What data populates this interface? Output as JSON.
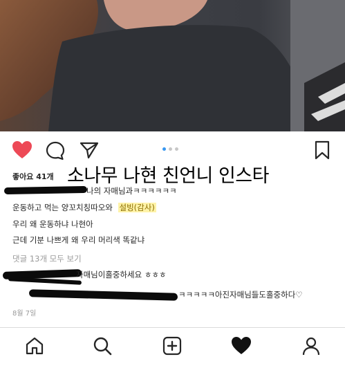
{
  "post": {
    "likes_label": "좋아요 41개",
    "overlay_caption": "소나무 나현 친언니 인스타",
    "caption_lines": [
      "나의 자매님과ㅋㅋㅋㅋㅋㅋ",
      "운동하고 먹는 양꼬치칭따오와",
      "설빙(감사)",
      "우리 왜 운동하냐 나현아",
      "근데 기분 나쁘게 왜 우리 머리색 똑같냐"
    ],
    "view_all_comments": "댓글 13개 모두 보기",
    "comments": [
      "자매님이홀중하세요 ㅎㅎㅎ",
      "ㅋㅋㅋㅋㅋ아진자매님들도홀중하다♡"
    ],
    "date": "8월 7일",
    "carousel": {
      "count": 3,
      "active_index": 1
    }
  },
  "icons": {
    "like": "heart-filled-icon",
    "comment": "comment-icon",
    "share": "paper-plane-icon",
    "save": "bookmark-icon",
    "nav": [
      "home-icon",
      "search-icon",
      "add-post-icon",
      "activity-heart-icon",
      "profile-icon"
    ]
  },
  "colors": {
    "like_red": "#ed4956",
    "carousel_active": "#3897f0",
    "highlight_bg": "#fff3a8"
  }
}
